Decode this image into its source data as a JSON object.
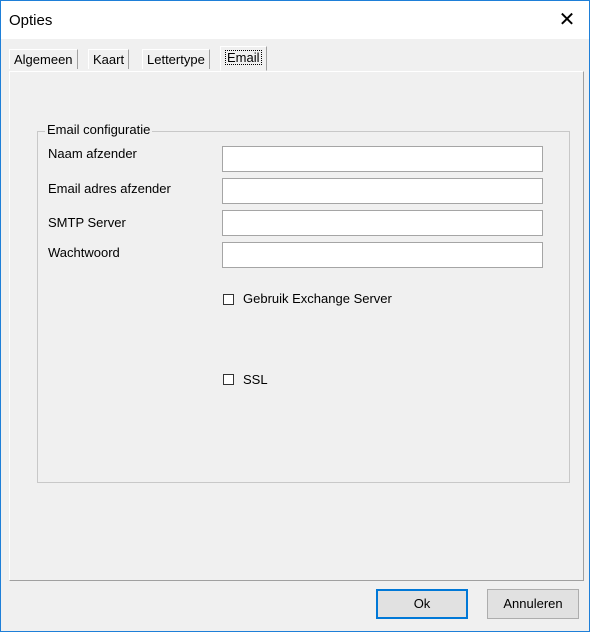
{
  "window": {
    "title": "Opties"
  },
  "tabs": [
    {
      "label": "Algemeen"
    },
    {
      "label": "Kaart"
    },
    {
      "label": "Lettertype"
    },
    {
      "label": "Email",
      "active": true
    }
  ],
  "email_group": {
    "legend": "Email configuratie",
    "fields": [
      {
        "label": "Naam afzender",
        "value": ""
      },
      {
        "label": "Email adres afzender",
        "value": ""
      },
      {
        "label": "SMTP Server",
        "value": ""
      },
      {
        "label": "Wachtwoord",
        "value": ""
      }
    ],
    "exchange_checkbox": {
      "label": "Gebruik Exchange Server",
      "checked": false
    },
    "ssl_checkbox": {
      "label": "SSL",
      "checked": false
    }
  },
  "buttons": {
    "ok": "Ok",
    "cancel": "Annuleren"
  },
  "icons": {
    "close": "close-icon"
  },
  "colors": {
    "window_border": "#1e7fd8",
    "default_button_border": "#0078d7"
  }
}
